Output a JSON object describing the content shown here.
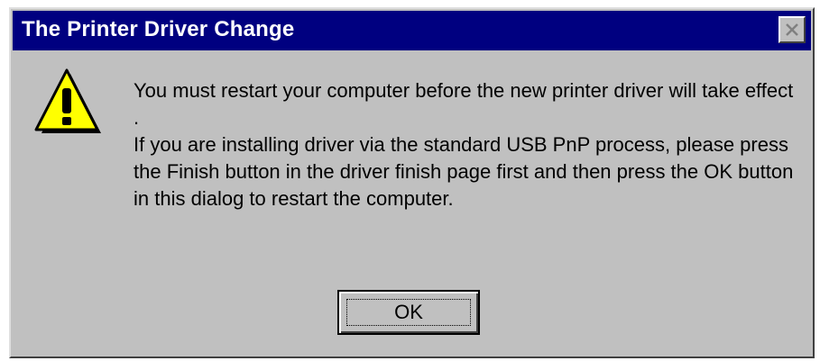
{
  "dialog": {
    "title": "The Printer Driver Change",
    "close_icon": "close-icon",
    "warning_icon": "warning-icon",
    "message_line1": "You must restart your computer before the new printer driver will take effect .",
    "message_line2": "If you are installing driver via the standard USB PnP process, please press the Finish button in the driver finish page first and then press the OK button in this dialog to restart the computer.",
    "ok_label": "OK"
  },
  "colors": {
    "titlebar": "#000080",
    "face": "#c0c0c0",
    "warning_fill": "#ffff00"
  }
}
